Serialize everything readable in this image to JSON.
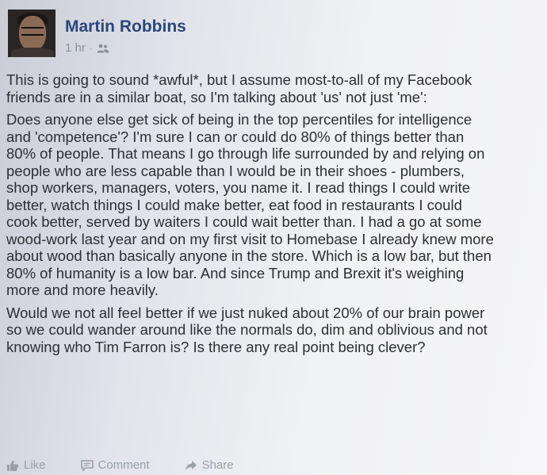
{
  "post": {
    "author": "Martin Robbins",
    "timestamp": "1 hr",
    "separator": "·",
    "audience_icon": "friends-icon",
    "paragraphs": [
      [
        "This is going to sound *awful*, but I assume most-to-all of my Facebook",
        "friends are in a similar boat, so I'm talking about 'us' not just 'me':"
      ],
      [
        "Does anyone else get sick of being in the top percentiles for intelligence",
        "and 'competence'? I'm sure I can or could do 80% of things better than",
        "80% of people. That means I go through life surrounded by and relying on",
        "people who are less capable than I would be in their shoes - plumbers,",
        "shop workers, managers, voters, you name it. I read things I could write",
        "better, watch things I could make better, eat food in restaurants I could",
        "cook better, served by waiters I could wait better than. I had a go at some",
        "wood-work last year and on my first visit to Homebase I already knew more",
        "about wood than basically anyone in the store. Which is a low bar, but then",
        "80% of humanity is a low bar. And since Trump and Brexit it's weighing",
        "more and more heavily."
      ],
      [
        "Would we not all feel better if we just nuked about 20% of our brain power",
        "so we could wander around like the normals do, dim and oblivious and not",
        "knowing who Tim Farron is? Is there any real point being clever?"
      ]
    ]
  },
  "actions": {
    "like": "Like",
    "comment": "Comment",
    "share": "Share"
  }
}
